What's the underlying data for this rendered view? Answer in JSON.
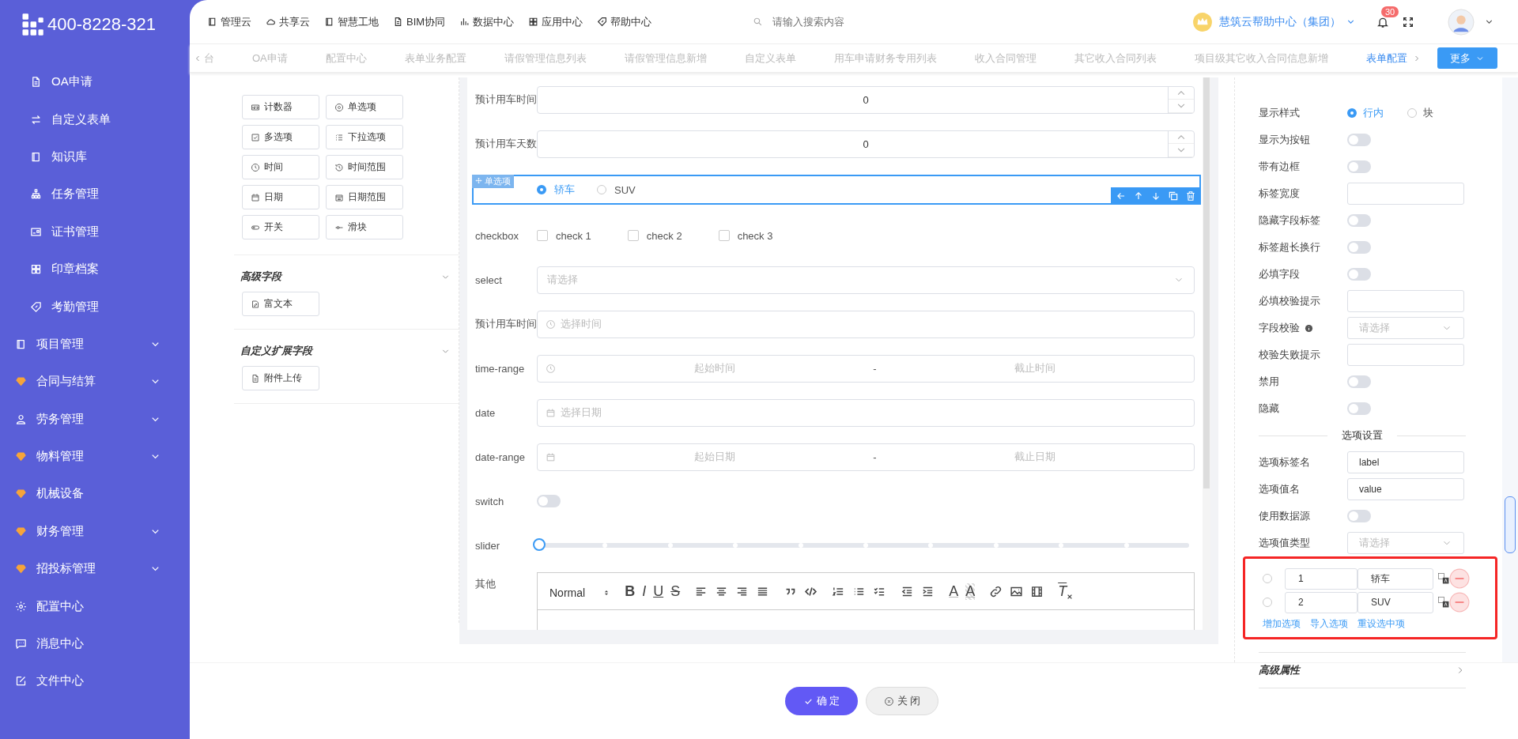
{
  "logo": {
    "phone": "400-8228-321"
  },
  "sidebar": {
    "items": [
      {
        "label": "OA申请",
        "kind": "sub",
        "has_children": false
      },
      {
        "label": "自定义表单",
        "kind": "sub",
        "has_children": false
      },
      {
        "label": "知识库",
        "kind": "sub",
        "has_children": false
      },
      {
        "label": "任务管理",
        "kind": "sub",
        "has_children": false
      },
      {
        "label": "证书管理",
        "kind": "sub",
        "has_children": false
      },
      {
        "label": "印章档案",
        "kind": "sub",
        "has_children": false
      },
      {
        "label": "考勤管理",
        "kind": "sub",
        "has_children": false
      },
      {
        "label": "项目管理",
        "kind": "top",
        "has_children": true
      },
      {
        "label": "合同与结算",
        "kind": "top",
        "has_children": true
      },
      {
        "label": "劳务管理",
        "kind": "top",
        "has_children": true
      },
      {
        "label": "物料管理",
        "kind": "top",
        "has_children": true
      },
      {
        "label": "机械设备",
        "kind": "top",
        "has_children": false
      },
      {
        "label": "财务管理",
        "kind": "top",
        "has_children": true
      },
      {
        "label": "招投标管理",
        "kind": "top",
        "has_children": true
      },
      {
        "label": "配置中心",
        "kind": "top",
        "has_children": false
      },
      {
        "label": "消息中心",
        "kind": "top",
        "has_children": false
      },
      {
        "label": "文件中心",
        "kind": "top",
        "has_children": false
      }
    ]
  },
  "top_nav": [
    "管理云",
    "共享云",
    "智慧工地",
    "BIM协同",
    "数据中心",
    "应用中心",
    "帮助中心"
  ],
  "search": {
    "placeholder": "请输入搜索内容"
  },
  "company": "慧筑云帮助中心（集团）",
  "notifications": {
    "count": "30"
  },
  "tabs": [
    {
      "label": "台",
      "selected": false
    },
    {
      "label": "OA申请",
      "selected": false
    },
    {
      "label": "配置中心",
      "selected": false
    },
    {
      "label": "表单业务配置",
      "selected": false
    },
    {
      "label": "请假管理信息列表",
      "selected": false
    },
    {
      "label": "请假管理信息新增",
      "selected": false
    },
    {
      "label": "自定义表单",
      "selected": false
    },
    {
      "label": "用车申请财务专用列表",
      "selected": false
    },
    {
      "label": "收入合同管理",
      "selected": false
    },
    {
      "label": "其它收入合同列表",
      "selected": false
    },
    {
      "label": "项目级其它收入合同信息新增",
      "selected": false
    },
    {
      "label": "表单配置",
      "selected": true
    }
  ],
  "more_button": "更多",
  "palette": {
    "basic": [
      "计数器",
      "单选项",
      "多选项",
      "下拉选项",
      "时间",
      "时间范围",
      "日期",
      "日期范围",
      "开关",
      "滑块"
    ],
    "sections": [
      {
        "title": "高级字段",
        "items": [
          "富文本"
        ]
      },
      {
        "title": "自定义扩展字段",
        "items": [
          "附件上传"
        ]
      }
    ]
  },
  "form": {
    "fields": [
      {
        "kind": "number",
        "label": "预计用车时间",
        "value": "0"
      },
      {
        "kind": "number",
        "label": "预计用车天数",
        "value": "0"
      },
      {
        "kind": "radio",
        "tag": "单选项",
        "options": [
          {
            "label": "轿车",
            "selected": true
          },
          {
            "label": "SUV",
            "selected": false
          }
        ]
      },
      {
        "kind": "checkbox",
        "label": "checkbox",
        "options": [
          {
            "label": "check 1",
            "checked": false
          },
          {
            "label": "check 2",
            "checked": false
          },
          {
            "label": "check 3",
            "checked": false
          }
        ]
      },
      {
        "kind": "select",
        "label": "select",
        "placeholder": "请选择"
      },
      {
        "kind": "time",
        "label": "预计用车时间",
        "placeholder": "选择时间"
      },
      {
        "kind": "range",
        "label": "time-range",
        "start": "起始时间",
        "sep": "-",
        "end": "截止时间"
      },
      {
        "kind": "date",
        "label": "date",
        "placeholder": "选择日期"
      },
      {
        "kind": "range",
        "label": "date-range",
        "start": "起始日期",
        "sep": "-",
        "end": "截止日期"
      },
      {
        "kind": "switch",
        "label": "switch",
        "on": false
      },
      {
        "kind": "slider",
        "label": "slider",
        "level": 0
      },
      {
        "kind": "editor",
        "label": "其他",
        "header": "Normal",
        "style_buttons": [
          "B",
          "I",
          "U",
          "S"
        ],
        "color_buttons": [
          "A",
          "A"
        ],
        "clear_button": "T"
      }
    ]
  },
  "properties": [
    {
      "kind": "radio",
      "label": "显示样式",
      "options": [
        {
          "label": "行内",
          "selected": true
        },
        {
          "label": "块",
          "selected": false
        }
      ]
    },
    {
      "kind": "switch",
      "label": "显示为按钮",
      "on": false
    },
    {
      "kind": "switch",
      "label": "带有边框",
      "on": false
    },
    {
      "kind": "input",
      "label": "标签宽度"
    },
    {
      "kind": "switch",
      "label": "隐藏字段标签",
      "on": false
    },
    {
      "kind": "switch",
      "label": "标签超长换行",
      "on": false
    },
    {
      "kind": "switch",
      "label": "必填字段",
      "on": false
    },
    {
      "kind": "input",
      "label": "必填校验提示"
    },
    {
      "kind": "select",
      "label": "字段校验",
      "info": true,
      "placeholder": "请选择"
    },
    {
      "kind": "input",
      "label": "校验失败提示"
    },
    {
      "kind": "switch",
      "label": "禁用",
      "on": false
    },
    {
      "kind": "switch",
      "label": "隐藏",
      "on": false
    },
    {
      "kind": "divider",
      "label": "选项设置"
    },
    {
      "kind": "input",
      "label": "选项标签名",
      "value": "label"
    },
    {
      "kind": "input",
      "label": "选项值名",
      "value": "value"
    },
    {
      "kind": "switch",
      "label": "使用数据源",
      "on": false
    },
    {
      "kind": "select",
      "label": "选项值类型",
      "placeholder": "请选择"
    }
  ],
  "option_rows": [
    {
      "value": "1",
      "label": "轿车",
      "selected": false
    },
    {
      "value": "2",
      "label": "SUV",
      "selected": false
    }
  ],
  "option_links": [
    "增加选项",
    "导入选项",
    "重设选中项"
  ],
  "advanced": {
    "title": "高级属性",
    "expanded": false
  },
  "footer": {
    "confirm": "确 定",
    "close": "关 闭"
  }
}
